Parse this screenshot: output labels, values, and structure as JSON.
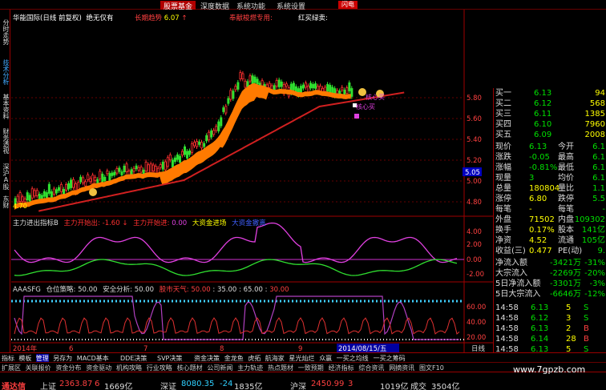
{
  "menu": {
    "items": [
      "股票基金",
      "深度数据",
      "系统功能",
      "系统设置"
    ],
    "close": "闪电"
  },
  "left_tabs": [
    "分时走势",
    "技术分析",
    "基本资料",
    "财务透视",
    "深沪A股",
    "东财"
  ],
  "chart_header": {
    "stock": "华能国际(日线 前复权)",
    "note": "绝无仅有",
    "trend_label": "长期趋势",
    "trend_value": "6.07",
    "dedicated": "奉献梭燃专用:",
    "redbuy": "红买绿卖:"
  },
  "price_axis": {
    "ticks": [
      "5.80",
      "5.60",
      "5.40",
      "5.20",
      "5.05",
      "5.00",
      "4.80"
    ],
    "current": "5.05"
  },
  "annotations": {
    "buy1": "核心买",
    "buy2": "核心买",
    "low": "4.70"
  },
  "indicator1": {
    "name": "主力进出指标B",
    "v1_label": "主力开始出:",
    "v1": "-1.60",
    "v2_label": "主力开始进:",
    "v2": "0.00",
    "v3": "大资金进场",
    "v4": "大资金撤离",
    "ticks": [
      "4.00",
      "2.00",
      "0.00",
      "-2.00"
    ]
  },
  "indicator2": {
    "name": "AAASFG",
    "pos_label": "仓位策略:",
    "pos": "50.00",
    "safe_label": "安全分析:",
    "safe": "50.00",
    "weather_label": "股市天气:",
    "w1": "50.00",
    "w2": "35.00",
    "w3": "65.00",
    "w4": "30.00",
    "ticks": [
      "60.00",
      "40.00",
      "20.00"
    ]
  },
  "date_axis": {
    "year": "2014年",
    "months": [
      "6",
      "7",
      "8",
      "9"
    ],
    "cursor": "2014/08/15/五",
    "period": "日线"
  },
  "right_panel": {
    "quotes": [
      {
        "label": "买一",
        "price": "6.13",
        "vol": "94"
      },
      {
        "label": "买二",
        "price": "6.12",
        "vol": "568"
      },
      {
        "label": "买三",
        "price": "6.11",
        "vol": "1385"
      },
      {
        "label": "买四",
        "price": "6.10",
        "vol": "7960"
      },
      {
        "label": "买五",
        "price": "6.09",
        "vol": "2008"
      }
    ],
    "stats": [
      {
        "a": "现价",
        "b": "6.13",
        "c": "今开",
        "d": "6.1"
      },
      {
        "a": "涨跌",
        "b": "-0.05",
        "c": "最高",
        "d": "6.1"
      },
      {
        "a": "涨幅",
        "b": "-0.81%",
        "c": "最低",
        "d": "6.1"
      },
      {
        "a": "现量",
        "b": "3",
        "c": "均价",
        "d": "6.1"
      },
      {
        "a": "总量",
        "b": "180804",
        "c": "量比",
        "d": "1.1"
      },
      {
        "a": "涨停",
        "b": "6.80",
        "c": "跌停",
        "d": "5.5"
      },
      {
        "a": "每笔",
        "b": "-",
        "c": "每笔",
        "d": "-"
      },
      {
        "a": "外盘",
        "b": "71502",
        "c": "内盘",
        "d": "109302"
      },
      {
        "a": "换手",
        "b": "0.17%",
        "c": "股本",
        "d": "141亿"
      },
      {
        "a": "净资",
        "b": "4.52",
        "c": "流通",
        "d": "105亿"
      },
      {
        "a": "收益(三)",
        "b": "0.477",
        "c": "PE(动)",
        "d": "9."
      }
    ],
    "flows": [
      {
        "a": "净流入额",
        "b": "-3421万",
        "c": "-31%"
      },
      {
        "a": "大宗流入",
        "b": "-2269万",
        "c": "-20%"
      },
      {
        "a": "5日净流入额",
        "b": "-3301万",
        "c": "-3%"
      },
      {
        "a": "5日大宗流入",
        "b": "-6646万",
        "c": "-12%"
      }
    ],
    "ticks": [
      {
        "t": "14:58",
        "p": "6.13",
        "v": "5",
        "s": "S"
      },
      {
        "t": "14:58",
        "p": "6.12",
        "v": "3",
        "s": "S"
      },
      {
        "t": "14:58",
        "p": "6.13",
        "v": "2",
        "s": "B"
      },
      {
        "t": "14:58",
        "p": "6.14",
        "v": "28",
        "s": "B"
      },
      {
        "t": "14:58",
        "p": "6.13",
        "v": "5",
        "s": "S"
      },
      {
        "t": "14:59",
        "p": "6.12",
        "v": "63",
        "s": "S"
      }
    ]
  },
  "bottom_tabs": [
    "指标",
    "模板",
    "管理",
    "另存为",
    "MACD基本",
    "DDE决策",
    "SVP决策",
    "资金决策",
    "金龙鱼",
    "虎拓",
    "航海家",
    "星光灿烂",
    "众赢",
    "一买之均线",
    "一买之筹码"
  ],
  "bottom_tabs2": [
    "扩展区",
    "关联报价",
    "资金分布",
    "资金驱动",
    "机构攻略",
    "行业攻略",
    "核心题材",
    "公司新闻",
    "主力轨迹",
    "热点题材",
    "一致预期",
    "经济指标",
    "综合资讯",
    "网摘资讯",
    "图文F10"
  ],
  "status": {
    "label": "通达信",
    "sh_label": "上证",
    "sh": "2363.87",
    "sh_chg": "6",
    "sh_amt": "1669亿",
    "sz_label": "深证",
    "sz": "8080.35",
    "sz_chg": "-24",
    "sz_amt": "1835亿",
    "hs_label": "沪深",
    "hs": "2450.99",
    "hs_chg": "3",
    "hs_amt": "1019亿",
    "total_label": "成交",
    "total": "3504亿"
  },
  "watermark": "www.7gpzb.com",
  "colors": {
    "up": "#ff3030",
    "down": "#30d0ff",
    "green": "#00e000",
    "yellow": "#ffff00",
    "magenta": "#e030e0",
    "orange": "#ff7a00"
  }
}
